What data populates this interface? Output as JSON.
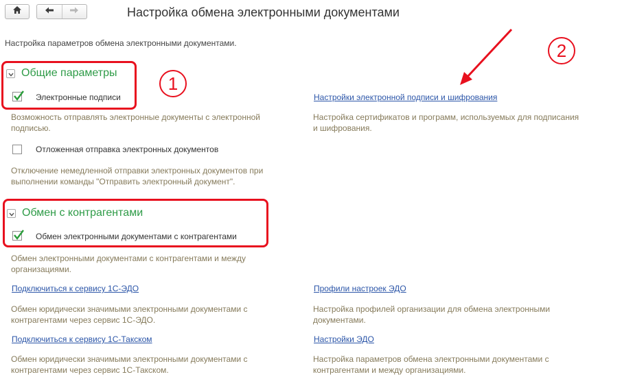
{
  "toolbar": {
    "home_icon": "home-icon",
    "back_icon": "arrow-left-icon",
    "forward_icon": "arrow-right-icon"
  },
  "page": {
    "title": "Настройка обмена электронными документами",
    "subtitle": "Настройка параметров обмена электронными документами."
  },
  "general": {
    "title": "Общие параметры",
    "signatures": {
      "label": "Электронные подписи",
      "checked": true,
      "desc_line1": "Возможность отправлять электронные документы с электронной",
      "desc_line2": "подписью."
    },
    "delayed": {
      "label": "Отложенная отправка электронных документов",
      "checked": false,
      "desc_line1": "Отключение немедленной отправки электронных документов при",
      "desc_line2": "выполнении команды \"Отправить электронный документ\"."
    },
    "crypto_link": {
      "label": "Настройки электронной подписи и шифрования",
      "desc_line1": "Настройка сертификатов и программ, используемых для подписания",
      "desc_line2": "и шифрования."
    }
  },
  "counterparties": {
    "title": "Обмен с контрагентами",
    "exchange": {
      "label": "Обмен электронными документами с контрагентами",
      "checked": true,
      "desc_line1": "Обмен электронными документами с контрагентами и между",
      "desc_line2": "организациями."
    },
    "edo_link": {
      "label": "Подключиться к сервису 1С-ЭДО",
      "desc_line1": "Обмен юридически значимыми электронными документами с",
      "desc_line2": "контрагентами через сервис 1С-ЭДО."
    },
    "taxcom_link": {
      "label": "Подключиться к сервису 1С-Такском",
      "desc_line1": "Обмен юридически значимыми электронными документами с",
      "desc_line2": "контрагентами через сервис 1С-Такском."
    },
    "profiles_link": {
      "label": "Профили настроек ЭДО",
      "desc_line1": "Настройка профилей организации для обмена электронными",
      "desc_line2": "документами."
    },
    "settings_link": {
      "label": "Настройки ЭДО",
      "desc_line1": "Настройка параметров обмена электронными документами с",
      "desc_line2": "контрагентами и между организациями."
    }
  },
  "annotations": {
    "marker1": "1",
    "marker2": "2",
    "color": "#e8101e"
  },
  "colors": {
    "group_title": "#2e9b47",
    "link": "#2b55a8",
    "description": "#857a5a"
  }
}
